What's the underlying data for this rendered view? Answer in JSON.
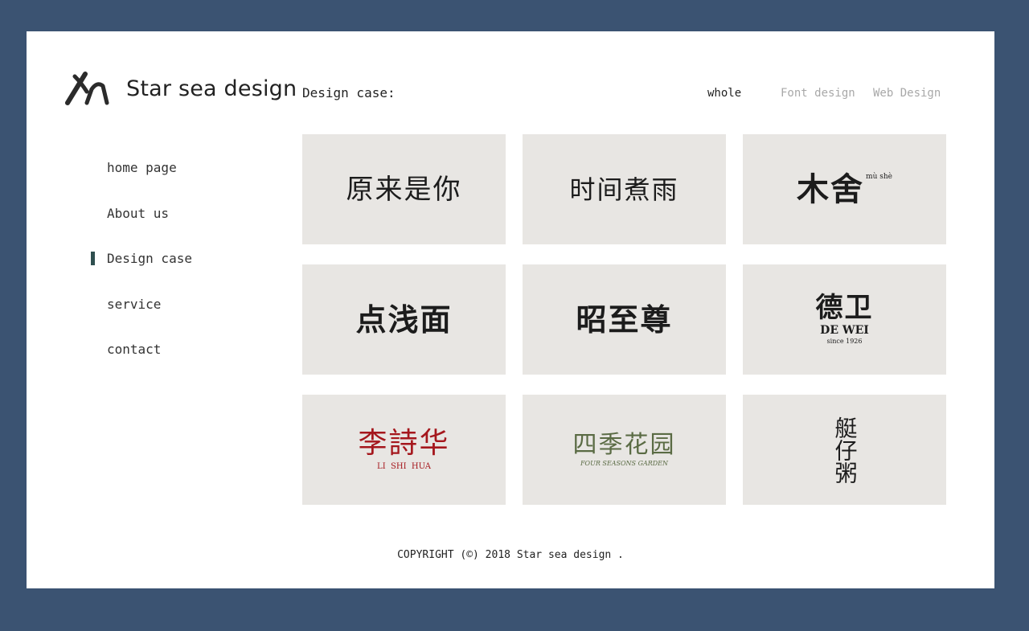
{
  "brand": {
    "name": "Star sea design",
    "logo_icon": "xh-monogram-logo"
  },
  "nav": {
    "items": [
      {
        "label": "home page",
        "active": false
      },
      {
        "label": "About us",
        "active": false
      },
      {
        "label": "Design case",
        "active": true
      },
      {
        "label": "service",
        "active": false
      },
      {
        "label": "contact",
        "active": false
      }
    ]
  },
  "main": {
    "section_title": "Design case:",
    "filters": [
      {
        "label": "whole",
        "active": true
      },
      {
        "label": "Font design",
        "active": false
      },
      {
        "label": "Web Design",
        "active": false
      }
    ],
    "cases": [
      {
        "title": "原来是你",
        "color": "#1c1c1c"
      },
      {
        "title": "时间煮雨",
        "color": "#1c1c1c"
      },
      {
        "title": "木舍",
        "subtitle": "mù shè",
        "color": "#1c1c1c"
      },
      {
        "title": "点浅面",
        "color": "#1c1c1c"
      },
      {
        "title": "昭至尊",
        "color": "#1c1c1c"
      },
      {
        "title": "德卫",
        "subtitle": "DE WEI",
        "caption": "since 1926",
        "color": "#1c1c1c"
      },
      {
        "title": "李詩华",
        "subtitle": "LI  SHI  HUA",
        "color": "#a5171d"
      },
      {
        "title": "四季花园",
        "subtitle": "FOUR SEASONS GARDEN",
        "color": "#5a6b44"
      },
      {
        "title": "艇仔粥",
        "color": "#1c1c1c"
      }
    ]
  },
  "footer": {
    "copyright": "COPYRIGHT (©) 2018 Star sea design ."
  },
  "colors": {
    "frame": "#3b5372",
    "card_bg": "#e8e6e3",
    "active_marker": "#2f4f4f",
    "filter_inactive": "#a8a8a8",
    "red_accent": "#a5171d",
    "green_accent": "#5a6b44"
  }
}
